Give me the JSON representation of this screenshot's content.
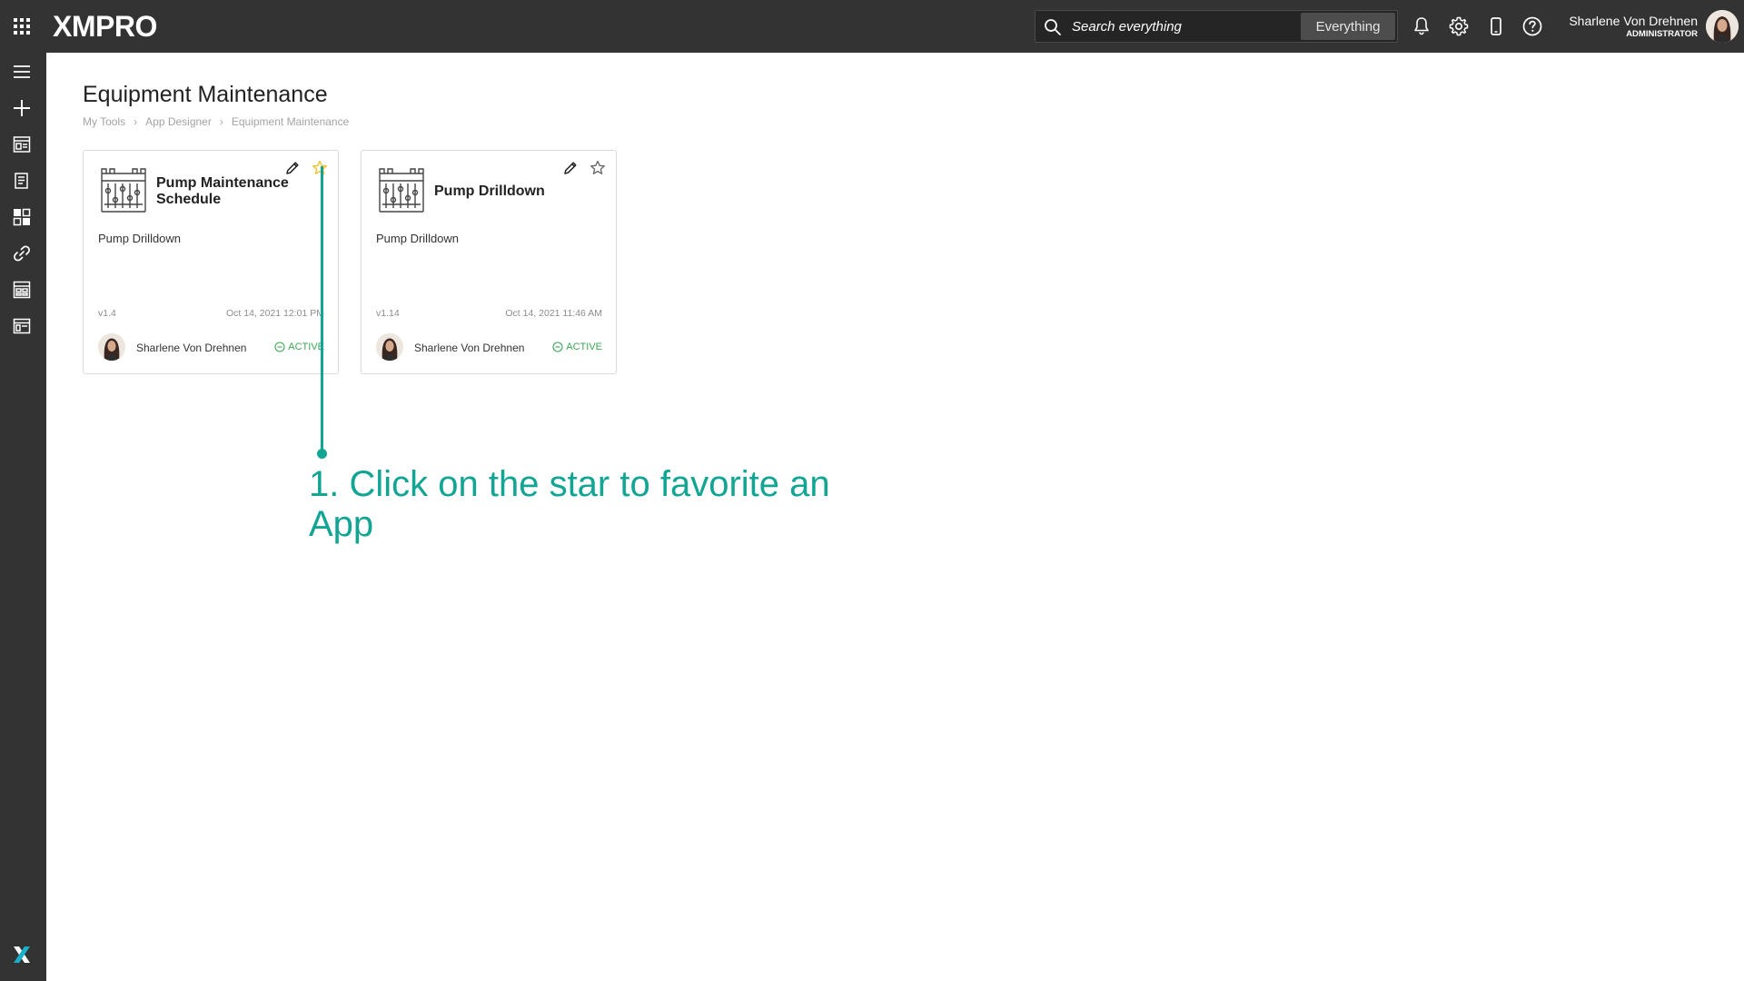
{
  "app": {
    "brand": "XMPRO"
  },
  "search": {
    "placeholder": "Search everything",
    "scope": "Everything"
  },
  "user": {
    "name": "Sharlene Von Drehnen",
    "role": "ADMINISTRATOR"
  },
  "page": {
    "title": "Equipment Maintenance",
    "breadcrumb": [
      "My Tools",
      "App Designer",
      "Equipment Maintenance"
    ]
  },
  "cards": [
    {
      "title_line1": "Pump Maintenance",
      "title_line2": "Schedule",
      "description": "Pump Drilldown",
      "version": "v1.4",
      "date": "Oct 14, 2021 12:01 PM",
      "owner": "Sharlene Von Drehnen",
      "status": "ACTIVE",
      "favorite": true
    },
    {
      "title_line1": "Pump Drilldown",
      "title_line2": "",
      "description": "Pump Drilldown",
      "version": "v1.14",
      "date": "Oct 14, 2021 11:46 AM",
      "owner": "Sharlene Von Drehnen",
      "status": "ACTIVE",
      "favorite": false
    }
  ],
  "annotation": {
    "text": "1. Click on the star to favorite an App"
  },
  "colors": {
    "topbar": "#333333",
    "sidebar": "#333333",
    "accent": "#12a594",
    "status_active": "#3aa757",
    "favorite_star": "#f2c12e"
  }
}
